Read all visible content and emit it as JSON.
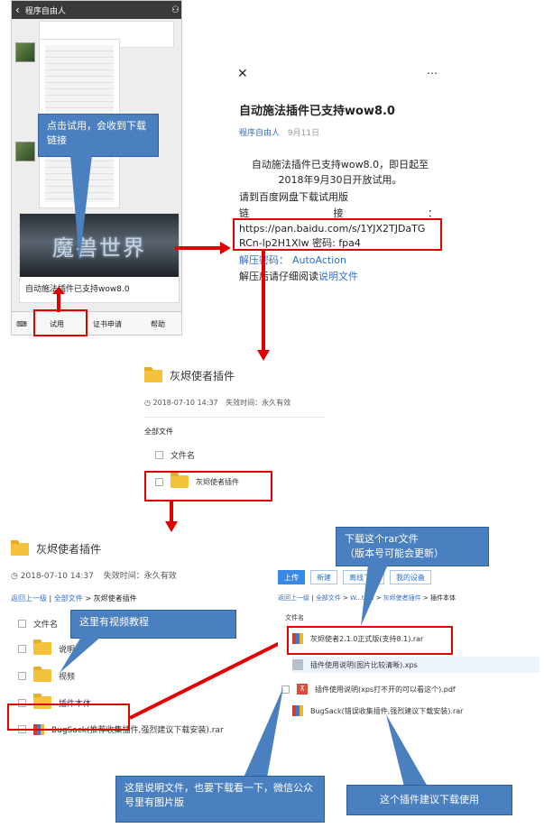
{
  "phone": {
    "title": "程序自由人",
    "card_title": "自动施法插件已支持wow8.0",
    "banner_text": "魔兽世界",
    "tabs": [
      "试用",
      "证书申请",
      "帮助"
    ]
  },
  "callouts": {
    "click_trial": "点击试用，会收到下载链接",
    "download_rar": "下载这个rar文件\n（版本号可能会更新）",
    "video_tutorial": "这里有视频教程",
    "manual": "这是说明文件，也要下载看一下，微信公众号里有图片版",
    "plugin_recommend": "这个插件建议下载使用"
  },
  "article": {
    "title": "自动施法插件已支持wow8.0",
    "author": "程序自由人",
    "date": "9月11日",
    "para1": "自动施法插件已支持wow8.0，即日起至2018年9月30日开放试用。",
    "para2": "请到百度网盘下载试用版",
    "link_label_left": "链",
    "link_label_mid": "接",
    "link_label_right": "：",
    "url_line1": "https://pan.baidu.com/s/1YJX2TJDaTG",
    "url_line2": "RCn-lp2H1Xlw 密码: fpa4",
    "unzip_label": "解压密码：",
    "unzip_value": "AutoAction",
    "after_text_prefix": "解压后请仔细阅读",
    "after_text_link": "说明文件"
  },
  "share1": {
    "folder": "灰烬使者插件",
    "date": "2018-07-10 14:37",
    "expiry": "失效时间：永久有效",
    "all_files": "全部文件",
    "col_name": "文件名",
    "row": "灰烬使者插件"
  },
  "share2": {
    "folder": "灰烬使者插件",
    "date": "2018-07-10 14:37",
    "expiry": "失效时间：永久有效",
    "crumb_back": "返回上一级",
    "crumb_all": "全部文件",
    "crumb_current": "灰烬使者插件",
    "col_name": "文件名",
    "rows": [
      "说明视",
      "视频",
      "插件本体",
      "BugSack(推荐收集插件,强烈建议下载安装).rar"
    ]
  },
  "share3": {
    "buttons": [
      "上传",
      "新建",
      "离线下载",
      "我的设备"
    ],
    "crumb_back": "返回上一级",
    "crumb_all": "全部文件",
    "crumb_mid1": "W...tion",
    "crumb_mid2": "灰烬使者插件",
    "crumb_current": "插件本体",
    "col_name": "文件名",
    "rows": [
      "灰烬使者2.1.0正式版(支持8.1).rar",
      "插件使用说明(图片比较清晰).xps",
      "插件使用说明(xps打不开的可以看这个).pdf",
      "BugSack(错误收集插件,强烈建议下载安装).rar"
    ]
  },
  "colors": {
    "accent": "#4a7fc0",
    "highlight": "#e00000",
    "folder": "#f5c33b",
    "link": "#2f6fd0"
  }
}
